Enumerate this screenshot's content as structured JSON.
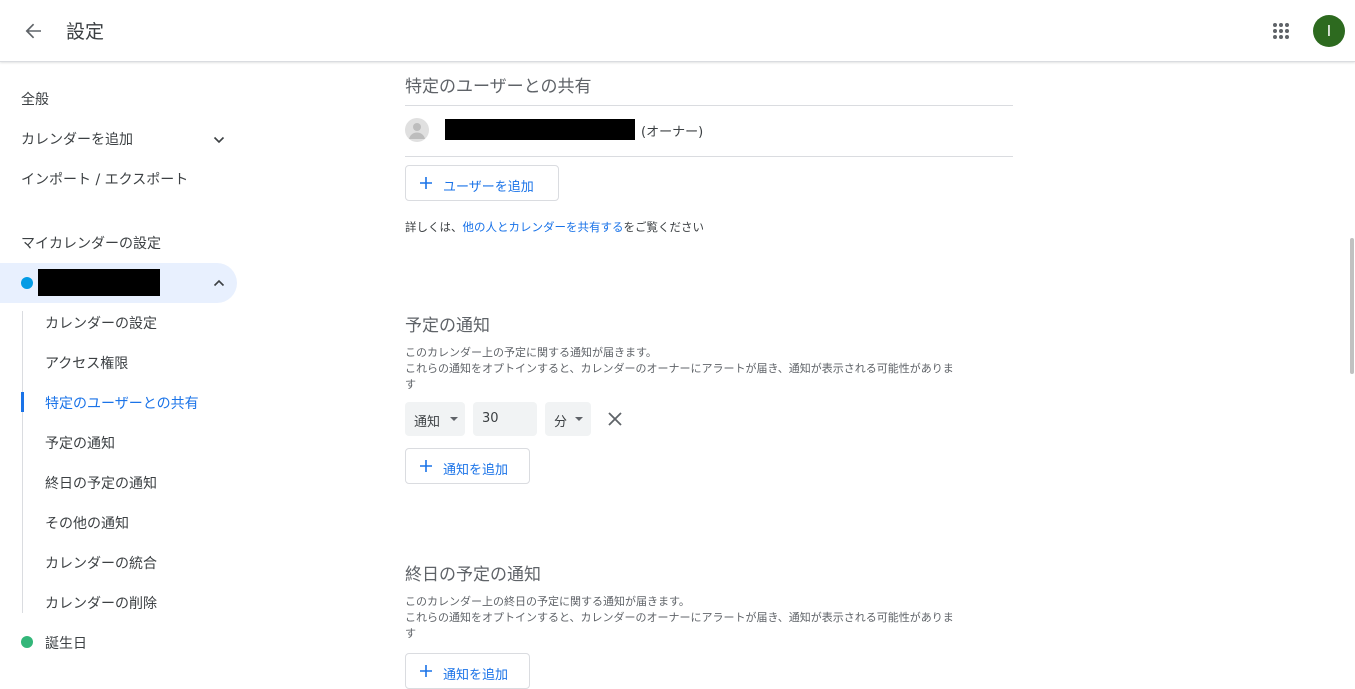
{
  "header": {
    "title": "設定",
    "avatar_letter": "I",
    "avatar_color": "#2d6a1f"
  },
  "sidebar": {
    "general": "全般",
    "add_calendar": "カレンダーを追加",
    "import_export": "インポート / エクスポート",
    "my_calendars_heading": "マイカレンダーの設定",
    "calendar_color": "#039be5",
    "sub_items": [
      "カレンダーの設定",
      "アクセス権限",
      "特定のユーザーとの共有",
      "予定の通知",
      "終日の予定の通知",
      "その他の通知",
      "カレンダーの統合",
      "カレンダーの削除"
    ],
    "active_sub_item": "特定のユーザーとの共有",
    "birthday": "誕生日",
    "birthday_color": "#33b679"
  },
  "sharing": {
    "title": "特定のユーザーとの共有",
    "owner_label": "(オーナー)",
    "add_user_label": "ユーザーを追加",
    "help_prefix": "詳しくは、",
    "help_link": "他の人とカレンダーを共有する",
    "help_suffix": "をご覧ください"
  },
  "event_notifications": {
    "title": "予定の通知",
    "desc_line1": "このカレンダー上の予定に関する通知が届きます。",
    "desc_line2": "これらの通知をオプトインすると、カレンダーのオーナーにアラートが届き、通知が表示される可能性がありま",
    "desc_line3": "す",
    "type_value": "通知",
    "amount_value": "30",
    "unit_value": "分",
    "add_label": "通知を追加"
  },
  "allday_notifications": {
    "title": "終日の予定の通知",
    "desc_line1": "このカレンダー上の終日の予定に関する通知が届きます。",
    "desc_line2": "これらの通知をオプトインすると、カレンダーのオーナーにアラートが届き、通知が表示される可能性がありま",
    "desc_line3": "す",
    "add_label": "通知を追加"
  },
  "accent_color": "#1a73e8"
}
